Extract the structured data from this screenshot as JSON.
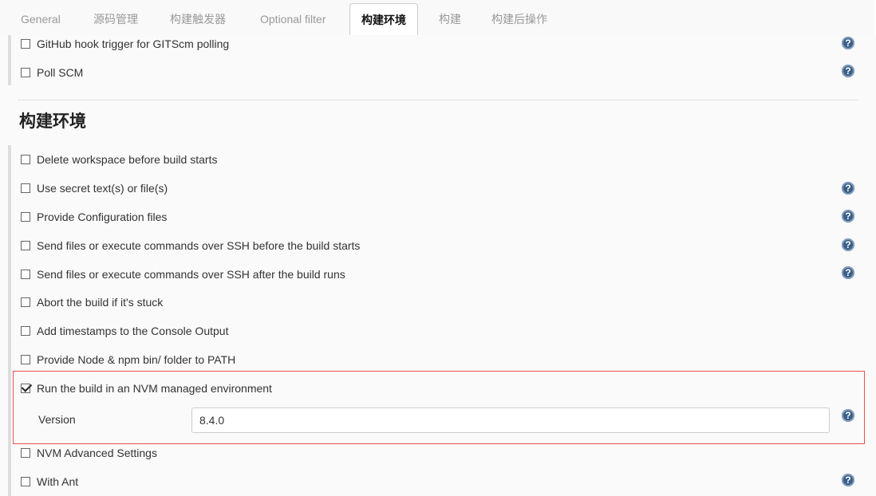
{
  "tabs": [
    {
      "label": "General",
      "active": false
    },
    {
      "label": "源码管理",
      "active": false
    },
    {
      "label": "构建触发器",
      "active": false
    },
    {
      "label": "Optional filter",
      "active": false
    },
    {
      "label": "构建环境",
      "active": true
    },
    {
      "label": "构建",
      "active": false
    },
    {
      "label": "构建后操作",
      "active": false
    }
  ],
  "triggers": [
    {
      "label": "GitHub hook trigger for GITScm polling",
      "checked": false,
      "help": true
    },
    {
      "label": "Poll SCM",
      "checked": false,
      "help": true
    }
  ],
  "section_title": "构建环境",
  "options": [
    {
      "label": "Delete workspace before build starts",
      "checked": false,
      "help": false
    },
    {
      "label": "Use secret text(s) or file(s)",
      "checked": false,
      "help": true
    },
    {
      "label": "Provide Configuration files",
      "checked": false,
      "help": true
    },
    {
      "label": "Send files or execute commands over SSH before the build starts",
      "checked": false,
      "help": true
    },
    {
      "label": "Send files or execute commands over SSH after the build runs",
      "checked": false,
      "help": true
    },
    {
      "label": "Abort the build if it's stuck",
      "checked": false,
      "help": false
    },
    {
      "label": "Add timestamps to the Console Output",
      "checked": false,
      "help": false
    },
    {
      "label": "Provide Node & npm bin/ folder to PATH",
      "checked": false,
      "help": false
    },
    {
      "label": "Run the build in an NVM managed environment",
      "checked": true,
      "help": false
    },
    {
      "label": "NVM Advanced Settings",
      "checked": false,
      "help": false
    },
    {
      "label": "With Ant",
      "checked": false,
      "help": true
    }
  ],
  "nvm": {
    "version_label": "Version",
    "version_value": "8.4.0"
  },
  "help_icon_glyph": "?",
  "colors": {
    "highlight_border": "#e8514f",
    "help_icon": "#3b5f86"
  }
}
